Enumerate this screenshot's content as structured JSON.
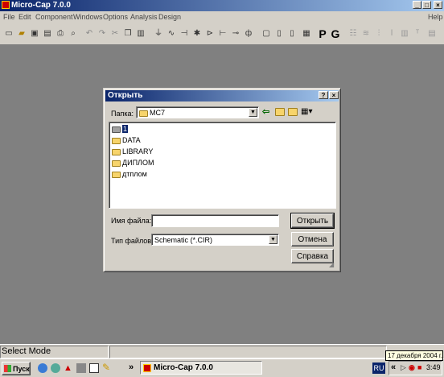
{
  "window": {
    "title": "Micro-Cap 7.0.0",
    "controls": {
      "minimize": "_",
      "maximize": "□",
      "close": "×"
    }
  },
  "menu": [
    "File",
    "Edit",
    "Component",
    "Windows",
    "Options",
    "Analysis",
    "Design"
  ],
  "menu_help": "Help",
  "toolbar": {
    "p_label": "P",
    "g_label": "G"
  },
  "dialog": {
    "title": "Открыть",
    "help_btn": "?",
    "close_btn": "×",
    "folder_label": "Папка:",
    "folder_value": "MC7",
    "files": [
      "1",
      "DATA",
      "LIBRARY",
      "ДИПЛОМ",
      "дтплом"
    ],
    "filename_label": "Имя файла:",
    "filename_value": "",
    "filetype_label": "Тип файлов:",
    "filetype_value": "Schematic (*.CIR)",
    "open_btn": "Открыть",
    "cancel_btn": "Отмена",
    "help_btn_text": "Справка"
  },
  "status": {
    "mode": "Select Mode"
  },
  "taskbar": {
    "start": "Пуск",
    "chevron": "»",
    "task": "Micro-Cap 7.0.0",
    "lang": "RU",
    "time": "3:49",
    "tooltip": "17 декабря 2004 г."
  }
}
